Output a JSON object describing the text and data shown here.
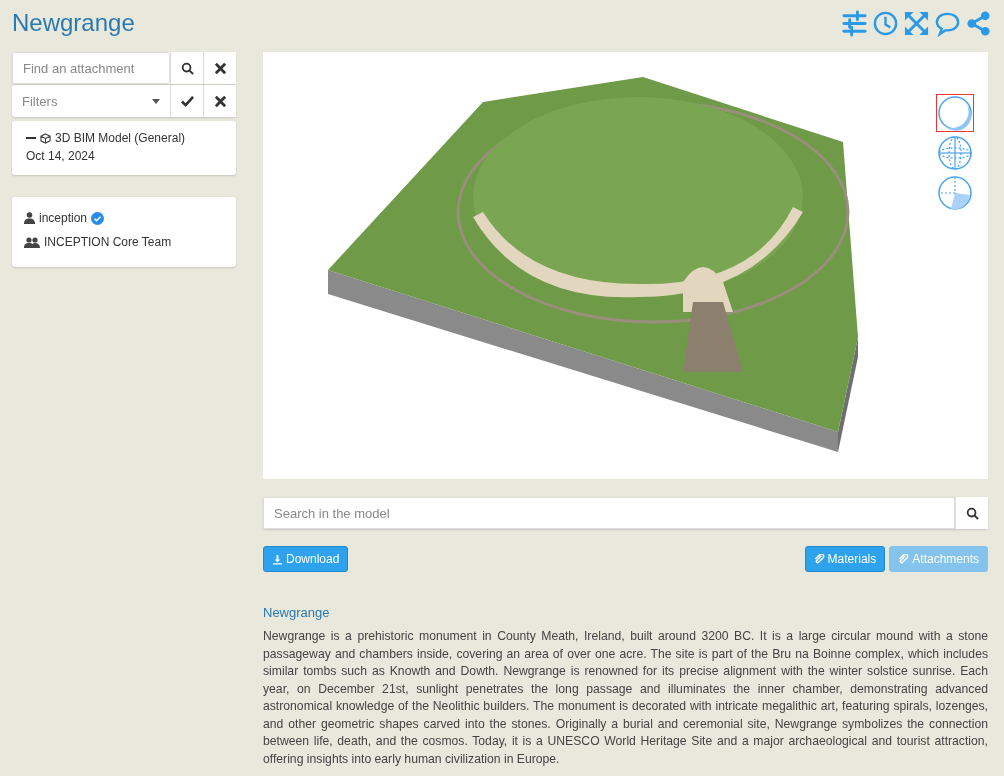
{
  "title": "Newgrange",
  "toolbar": [
    {
      "kind": "sliders"
    },
    {
      "kind": "clock"
    },
    {
      "kind": "expand"
    },
    {
      "kind": "comment"
    },
    {
      "kind": "share"
    }
  ],
  "sidebar": {
    "attachment_search": {
      "placeholder": "Find an attachment"
    },
    "filters": {
      "placeholder": "Filters"
    },
    "attachment": {
      "name": "3D BIM Model (General)",
      "date": "Oct 14, 2024",
      "expanded": true
    },
    "people": [
      {
        "kind": "user",
        "name": "inception",
        "verified": true
      },
      {
        "kind": "group",
        "name": "INCEPTION Core Team",
        "verified": false
      }
    ]
  },
  "viewer": {
    "view_modes": [
      {
        "kind": "shaded",
        "selected": true
      },
      {
        "kind": "wireframe",
        "selected": false
      },
      {
        "kind": "section",
        "selected": false
      }
    ]
  },
  "model_search": {
    "placeholder": "Search in the model"
  },
  "buttons": [
    {
      "kind": "download",
      "label": "Download",
      "disabled": false
    },
    {
      "kind": "materials",
      "label": "Materials",
      "disabled": false
    },
    {
      "kind": "attachments",
      "label": "Attachments",
      "disabled": true
    }
  ],
  "description": {
    "heading": "Newgrange",
    "text": "Newgrange is a prehistoric monument in County Meath, Ireland, built around 3200 BC. It is a large circular mound with a stone passageway and chambers inside, covering an area of over one acre. The site is part of the Bru na Boinne complex, which includes similar tombs such as Knowth and Dowth. Newgrange is renowned for its precise alignment with the winter solstice sunrise. Each year, on December 21st, sunlight penetrates the long passage and illuminates the inner chamber, demonstrating advanced astronomical knowledge of the Neolithic builders. The monument is decorated with intricate megalithic art, featuring spirals, lozenges, and other geometric shapes carved into the stones. Originally a burial and ceremonial site, Newgrange symbolizes the connection between life, death, and the cosmos. Today, it is a UNESCO World Heritage Site and a major archaeological and tourist attraction, offering insights into early human civilization in Europe."
  }
}
